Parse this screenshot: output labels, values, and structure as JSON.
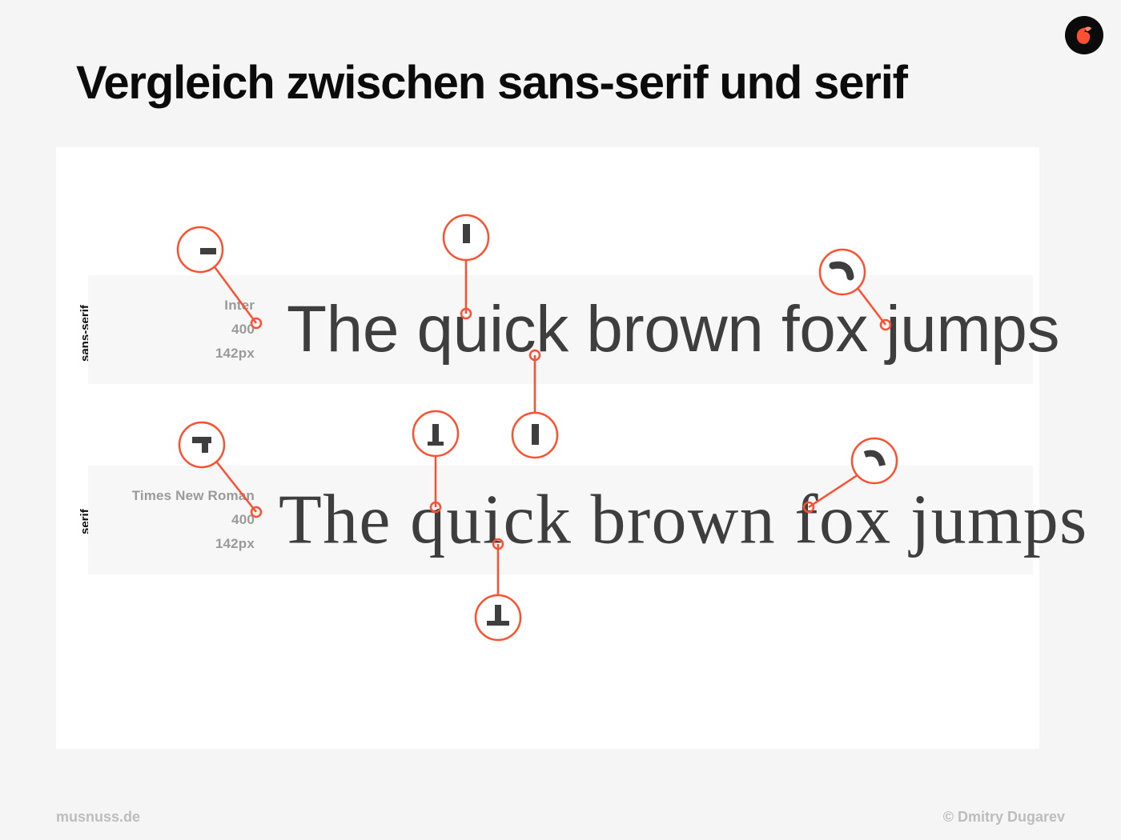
{
  "title": "Vergleich zwischen sans-serif und serif",
  "rows": {
    "sans": {
      "axis": "sans-serif",
      "font_name": "Inter",
      "font_weight": "400",
      "font_size": "142px",
      "sample": "The quick brown fox jumps"
    },
    "serif": {
      "axis": "serif",
      "font_name": "Times New Roman",
      "font_weight": "400",
      "font_size": "142px",
      "sample": "The quick brown fox jumps"
    }
  },
  "footer": {
    "left": "musnuss.de",
    "right": "© Dmitry Dugarev"
  },
  "accent": "#fc5130"
}
